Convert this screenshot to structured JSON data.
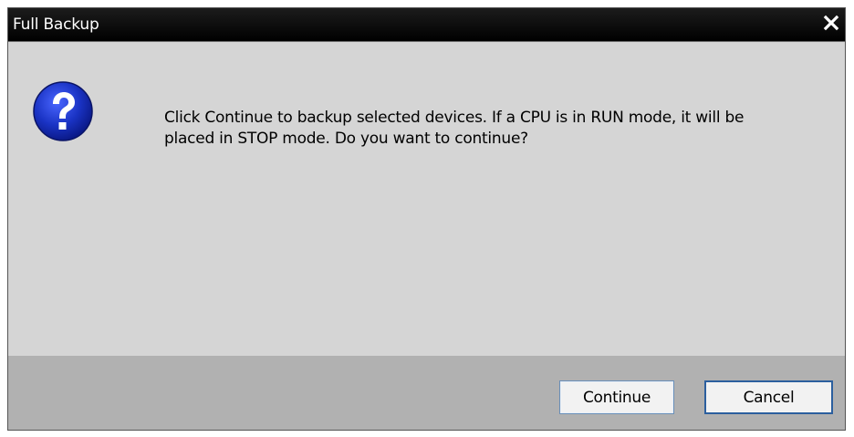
{
  "dialog": {
    "title": "Full Backup",
    "message_line1": "Click Continue to backup selected devices. If a CPU is in RUN mode, it will be",
    "message_line2": "placed in STOP mode. Do you want to continue?",
    "icon": "question-icon",
    "buttons": {
      "continue_label": "Continue",
      "cancel_label": "Cancel"
    }
  },
  "colors": {
    "titlebar": "#000000",
    "title_text": "#ffffff",
    "content_background": "#d5d5d5",
    "footer_background": "#b1b1b1",
    "icon_blue": "#1a33c4",
    "button_border": "#2c5f9e"
  }
}
